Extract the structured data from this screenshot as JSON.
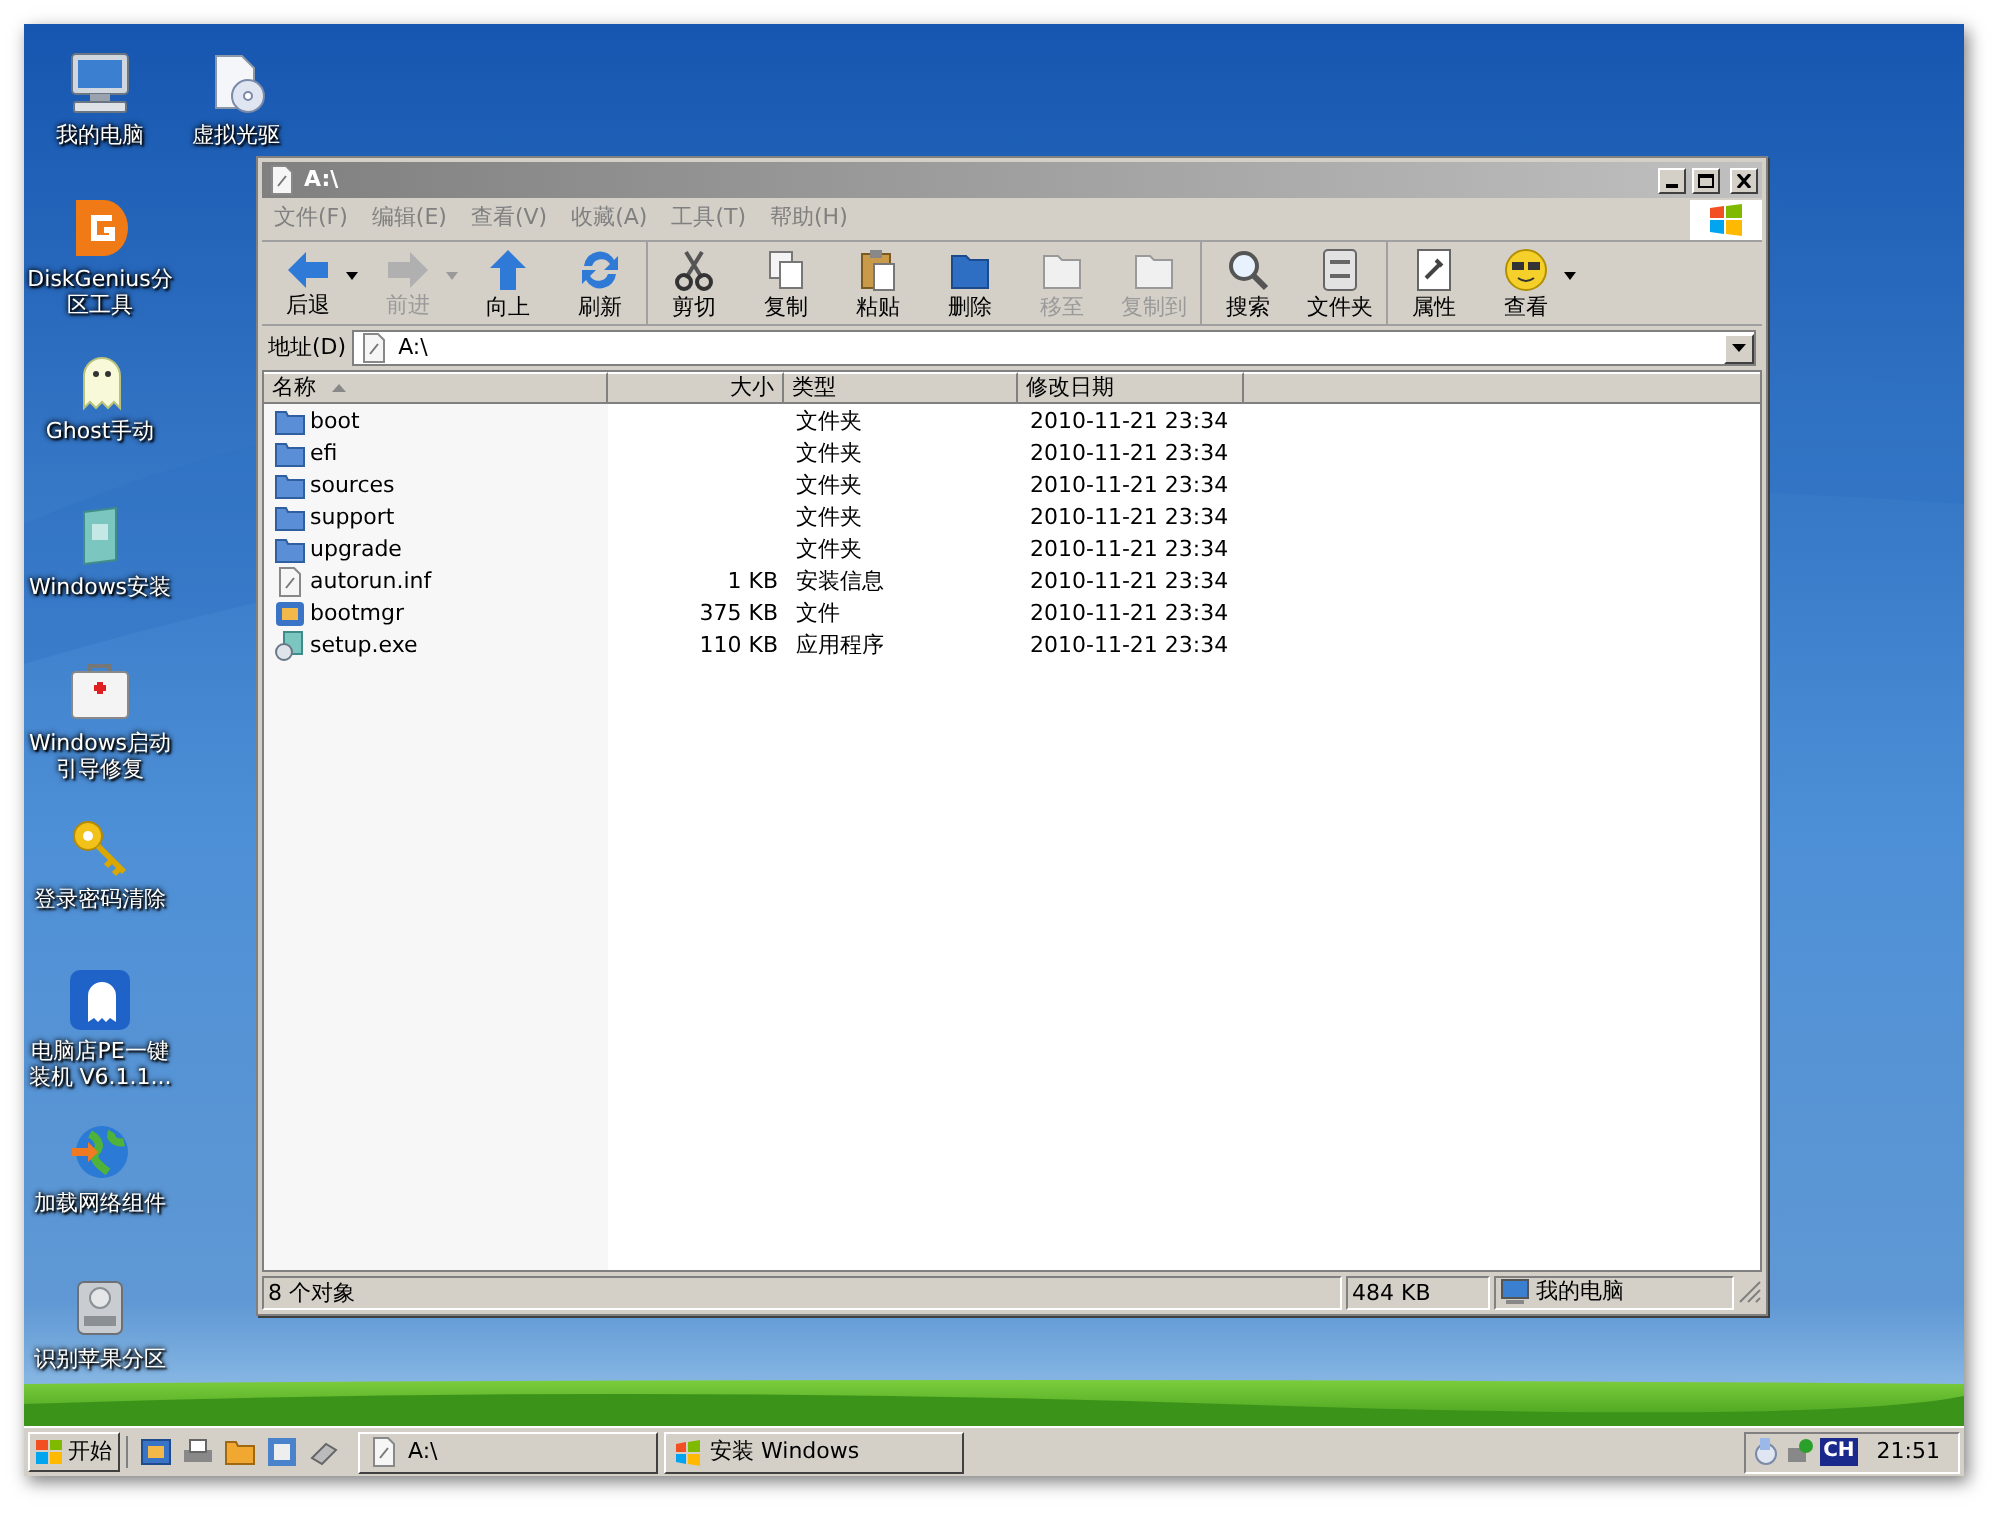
{
  "desktop": {
    "icons": [
      {
        "label": "我的电脑",
        "kind": "computer"
      },
      {
        "label": "虚拟光驱",
        "kind": "disc"
      },
      {
        "label": "DiskGenius分区工具",
        "kind": "diskgenius"
      },
      {
        "label": "Ghost手动",
        "kind": "ghost"
      },
      {
        "label": "Windows安装",
        "kind": "setup"
      },
      {
        "label": "Windows启动引导修复",
        "kind": "toolbox"
      },
      {
        "label": "登录密码清除",
        "kind": "key"
      },
      {
        "label": "电脑店PE一键装机 V6.1.1...",
        "kind": "pe"
      },
      {
        "label": "加载网络组件",
        "kind": "globe"
      },
      {
        "label": "识别苹果分区",
        "kind": "drive"
      }
    ]
  },
  "window": {
    "title": "A:\\",
    "menu": [
      "文件(F)",
      "编辑(E)",
      "查看(V)",
      "收藏(A)",
      "工具(T)",
      "帮助(H)"
    ],
    "toolbar": [
      [
        {
          "label": "后退",
          "kind": "back",
          "dropdown": true,
          "disabled": false
        },
        {
          "label": "前进",
          "kind": "forward",
          "dropdown": true,
          "disabled": true
        },
        {
          "label": "向上",
          "kind": "up",
          "dropdown": false,
          "disabled": false
        },
        {
          "label": "刷新",
          "kind": "refresh",
          "dropdown": false,
          "disabled": false
        }
      ],
      [
        {
          "label": "剪切",
          "kind": "cut",
          "dropdown": false,
          "disabled": false
        },
        {
          "label": "复制",
          "kind": "copy",
          "dropdown": false,
          "disabled": false
        },
        {
          "label": "粘贴",
          "kind": "paste",
          "dropdown": false,
          "disabled": false
        },
        {
          "label": "删除",
          "kind": "delete",
          "dropdown": false,
          "disabled": false
        },
        {
          "label": "移至",
          "kind": "move",
          "dropdown": false,
          "disabled": true
        },
        {
          "label": "复制到",
          "kind": "move",
          "dropdown": false,
          "disabled": true
        }
      ],
      [
        {
          "label": "搜索",
          "kind": "search",
          "dropdown": false,
          "disabled": false
        },
        {
          "label": "文件夹",
          "kind": "folders",
          "dropdown": false,
          "disabled": false
        }
      ],
      [
        {
          "label": "属性",
          "kind": "properties",
          "dropdown": false,
          "disabled": false
        },
        {
          "label": "查看",
          "kind": "views",
          "dropdown": true,
          "disabled": false
        }
      ]
    ],
    "address": {
      "label": "地址(D)",
      "value": "A:\\"
    },
    "columns": [
      {
        "label": "名称",
        "sorted": true
      },
      {
        "label": "大小",
        "sorted": false
      },
      {
        "label": "类型",
        "sorted": false
      },
      {
        "label": "修改日期",
        "sorted": false
      }
    ],
    "rows": [
      {
        "name": "boot",
        "size": "",
        "type": "文件夹",
        "modified": "2010-11-21 23:34",
        "kind": "folder"
      },
      {
        "name": "efi",
        "size": "",
        "type": "文件夹",
        "modified": "2010-11-21 23:34",
        "kind": "folder"
      },
      {
        "name": "sources",
        "size": "",
        "type": "文件夹",
        "modified": "2010-11-21 23:34",
        "kind": "folder"
      },
      {
        "name": "support",
        "size": "",
        "type": "文件夹",
        "modified": "2010-11-21 23:34",
        "kind": "folder"
      },
      {
        "name": "upgrade",
        "size": "",
        "type": "文件夹",
        "modified": "2010-11-21 23:34",
        "kind": "folder"
      },
      {
        "name": "autorun.inf",
        "size": "1 KB",
        "type": "安装信息",
        "modified": "2010-11-21 23:34",
        "kind": "inf"
      },
      {
        "name": "bootmgr",
        "size": "375 KB",
        "type": "文件",
        "modified": "2010-11-21 23:34",
        "kind": "system"
      },
      {
        "name": "setup.exe",
        "size": "110 KB",
        "type": "应用程序",
        "modified": "2010-11-21 23:34",
        "kind": "exe"
      }
    ],
    "status_bar": {
      "objects": "8 个对象",
      "size": "484 KB",
      "location": "我的电脑"
    }
  },
  "taskbar": {
    "start": "开始",
    "quick_launch": [
      {
        "kind": "screen"
      },
      {
        "kind": "printer"
      },
      {
        "kind": "folder"
      },
      {
        "kind": "network"
      },
      {
        "kind": "eraser"
      }
    ],
    "tasks": [
      {
        "label": "A:\\",
        "kind": "drive"
      },
      {
        "label": "安装 Windows",
        "kind": "windows"
      }
    ],
    "tray": {
      "language": "CH",
      "time": "21:51"
    }
  }
}
